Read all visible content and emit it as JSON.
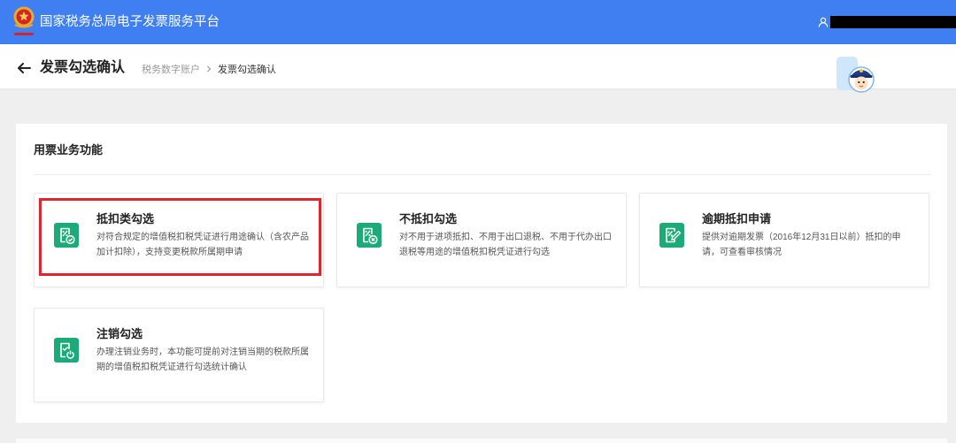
{
  "header": {
    "title": "国家税务总局电子发票服务平台",
    "logo_icon": "tax-emblem-icon",
    "user_icon": "user-icon"
  },
  "subheader": {
    "back_icon": "arrow-left-icon",
    "title": "发票勾选确认",
    "breadcrumb": [
      "税务数字账户",
      "发票勾选确认"
    ],
    "separator_icon": "chevron-right-icon",
    "assistant_icon": "mascot-avatar-icon"
  },
  "section": {
    "title": "用票业务功能",
    "functions": [
      {
        "title": "抵扣类勾选",
        "icon": "invoice-check-icon",
        "desc_lines": [
          "对符合规定的增值税扣税凭证进行用途确认（含农产品",
          "加计扣除），支持变更税款所属期申请"
        ]
      },
      {
        "title": "不抵扣勾选",
        "icon": "invoice-cross-icon",
        "desc_lines": [
          "对不用于进项抵扣、不用于出口退税、不用于代办出口",
          "退税等用途的增值税扣税凭证进行勾选"
        ]
      },
      {
        "title": "逾期抵扣申请",
        "icon": "invoice-edit-icon",
        "desc_lines": [
          "提供对逾期发票（2016年12月31日以前）抵扣的申",
          "请，可查看审核情况"
        ]
      },
      {
        "title": "注销勾选",
        "icon": "invoice-power-icon",
        "desc_lines": [
          "办理注销业务时，本功能可提前对注销当期的税款所属",
          "期的增值税扣税凭证进行勾选统计确认"
        ]
      }
    ]
  },
  "colors": {
    "header_bg": "#3f7ff2",
    "icon_green": "#1bab78",
    "highlight_red": "#e0262c",
    "page_bg": "#efefef"
  }
}
